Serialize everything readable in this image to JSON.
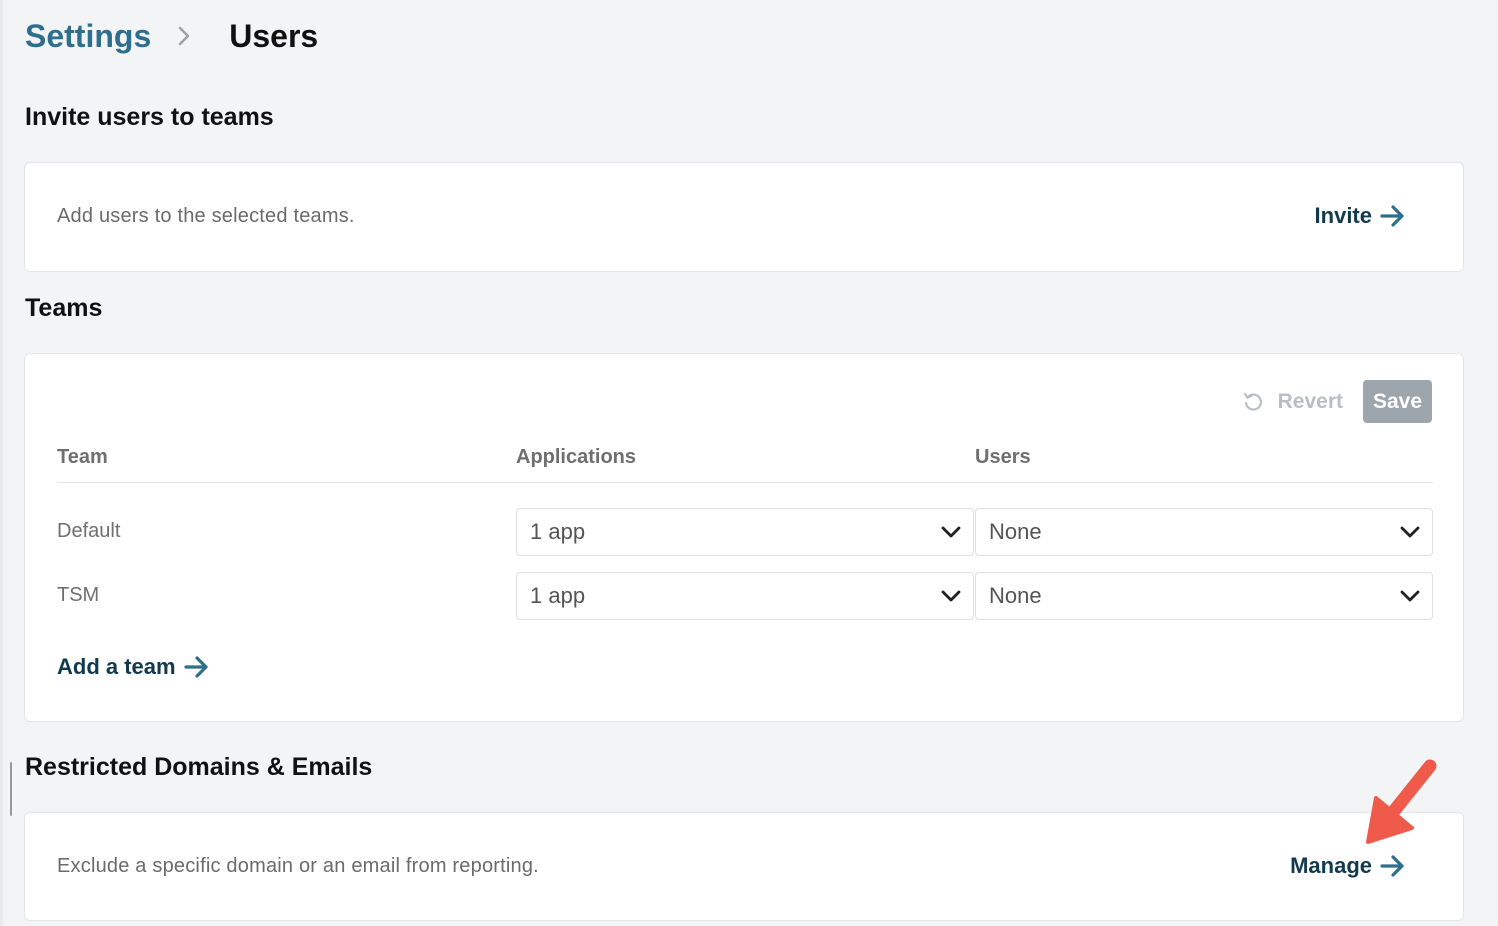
{
  "breadcrumb": {
    "parent": "Settings",
    "current": "Users"
  },
  "invite": {
    "title": "Invite users to teams",
    "description": "Add users to the selected teams.",
    "action_label": "Invite"
  },
  "teams": {
    "title": "Teams",
    "revert_label": "Revert",
    "save_label": "Save",
    "columns": [
      "Team",
      "Applications",
      "Users"
    ],
    "rows": [
      {
        "team": "Default",
        "applications": "1 app",
        "users": "None"
      },
      {
        "team": "TSM",
        "applications": "1 app",
        "users": "None"
      }
    ],
    "add_team_label": "Add a team"
  },
  "restricted": {
    "title": "Restricted Domains & Emails",
    "description": "Exclude a specific domain or an email from reporting.",
    "action_label": "Manage"
  },
  "colors": {
    "breadcrumb_link": "#2e6f8e",
    "action_link": "#123a4e",
    "annotation_arrow": "#f05a4a",
    "save_disabled": "#9da6ad"
  },
  "icons": [
    "chevron-right-icon",
    "arrow-right-icon",
    "revert-icon",
    "chevron-down-icon",
    "annotation-arrow-icon"
  ]
}
